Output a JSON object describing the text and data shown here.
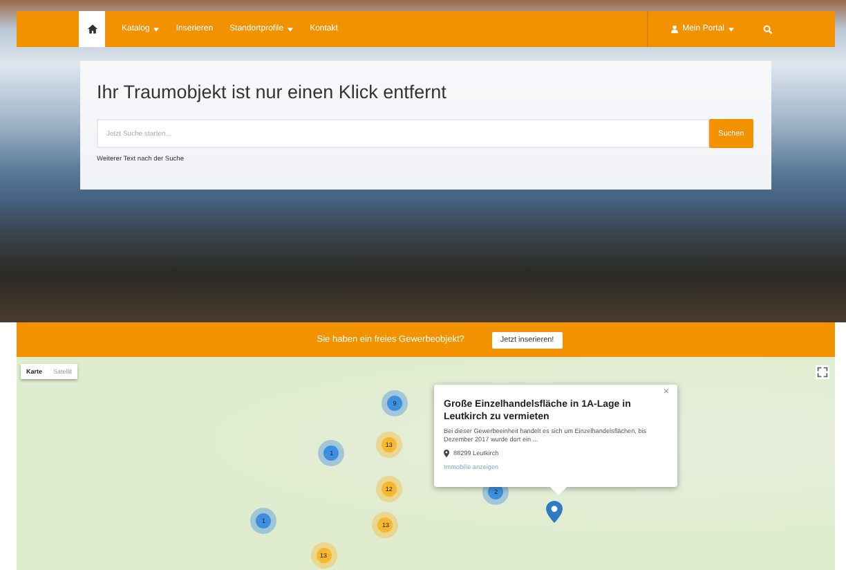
{
  "navbar": {
    "items": [
      {
        "kind": "home",
        "selected": true
      },
      {
        "kind": "link",
        "label": "Katalog",
        "dropdown": true,
        "selected": false
      },
      {
        "kind": "link",
        "label": "Inserieren",
        "dropdown": false,
        "selected": false
      },
      {
        "kind": "link",
        "label": "Standortprofile",
        "dropdown": true,
        "selected": false
      },
      {
        "kind": "link",
        "label": "Kontakt",
        "dropdown": false,
        "selected": false
      }
    ],
    "portal": {
      "label": "Mein Portal",
      "dropdown": true
    }
  },
  "hero": {
    "title": "Ihr Traumobjekt ist nur einen Klick entfernt",
    "search": {
      "placeholder": "Jetzt Suche starten...",
      "button": "Suchen"
    },
    "note": "Weiterer Text nach der Suche"
  },
  "banner": {
    "text": "Sie haben ein freies Gewerbeobjekt?",
    "button": "Jetzt inserieren!"
  },
  "map": {
    "types": [
      {
        "label": "Karte",
        "selected": true
      },
      {
        "label": "Satellit",
        "selected": false
      }
    ],
    "clusters": [
      {
        "count": "9",
        "color": "#3f8fe0"
      },
      {
        "count": "1",
        "color": "#3f8fe0"
      },
      {
        "count": "13",
        "color": "#f5b82e"
      },
      {
        "count": "12",
        "color": "#f5b82e"
      },
      {
        "count": "13",
        "color": "#f5b82e"
      },
      {
        "count": "1",
        "color": "#3f8fe0"
      },
      {
        "count": "13",
        "color": "#f5b82e"
      },
      {
        "count": "2",
        "color": "#3f8fe0"
      }
    ],
    "info": {
      "close": "×",
      "title": "Große Einzelhandelsfläche in 1A-Lage in Leutkirch zu vermieten",
      "text": "Bei dieser Gewerbeeinheit handelt es sich um Einzelhandelsflächen, bis Dezember 2017 wurde dort ein ...",
      "location": "88299 Leutkirch",
      "link": "Immobilie anzeigen"
    }
  }
}
